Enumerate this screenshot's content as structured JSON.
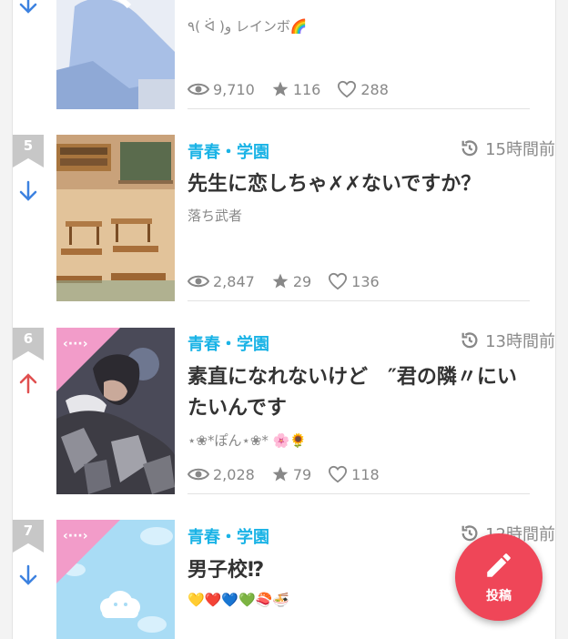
{
  "items": [
    {
      "rank": "",
      "trend": "down",
      "genre": "",
      "time": "",
      "title": "",
      "author": "٩( ᐛ )و レインボ🌈",
      "views": "9,710",
      "stars": "116",
      "likes": "288"
    },
    {
      "rank": "5",
      "trend": "down",
      "genre": "青春・学園",
      "time": "15時間前",
      "title": "先生に恋しちゃ✗✗ないですか？",
      "author": "落ち武者",
      "views": "2,847",
      "stars": "29",
      "likes": "136"
    },
    {
      "rank": "6",
      "trend": "up",
      "genre": "青春・学園",
      "time": "13時間前",
      "title_line1": "素直になれないけど　″君の隣〃にい",
      "title_line2": "たいんです",
      "author": "⋆❀*ぽん⋆❀* 🌸🌻",
      "views": "2,028",
      "stars": "79",
      "likes": "118"
    },
    {
      "rank": "7",
      "trend": "down",
      "genre": "青春・学園",
      "time": "12時間前",
      "title": "男子校⁉",
      "author": "💛❤️💙💚🍣🍜"
    }
  ],
  "fab": {
    "label": "投稿"
  },
  "colors": {
    "genre": "#1ab3e6",
    "down": "#3d82e0",
    "up": "#e05050",
    "rank_bg": "#c7c7c7",
    "fab": "#ef4658"
  }
}
